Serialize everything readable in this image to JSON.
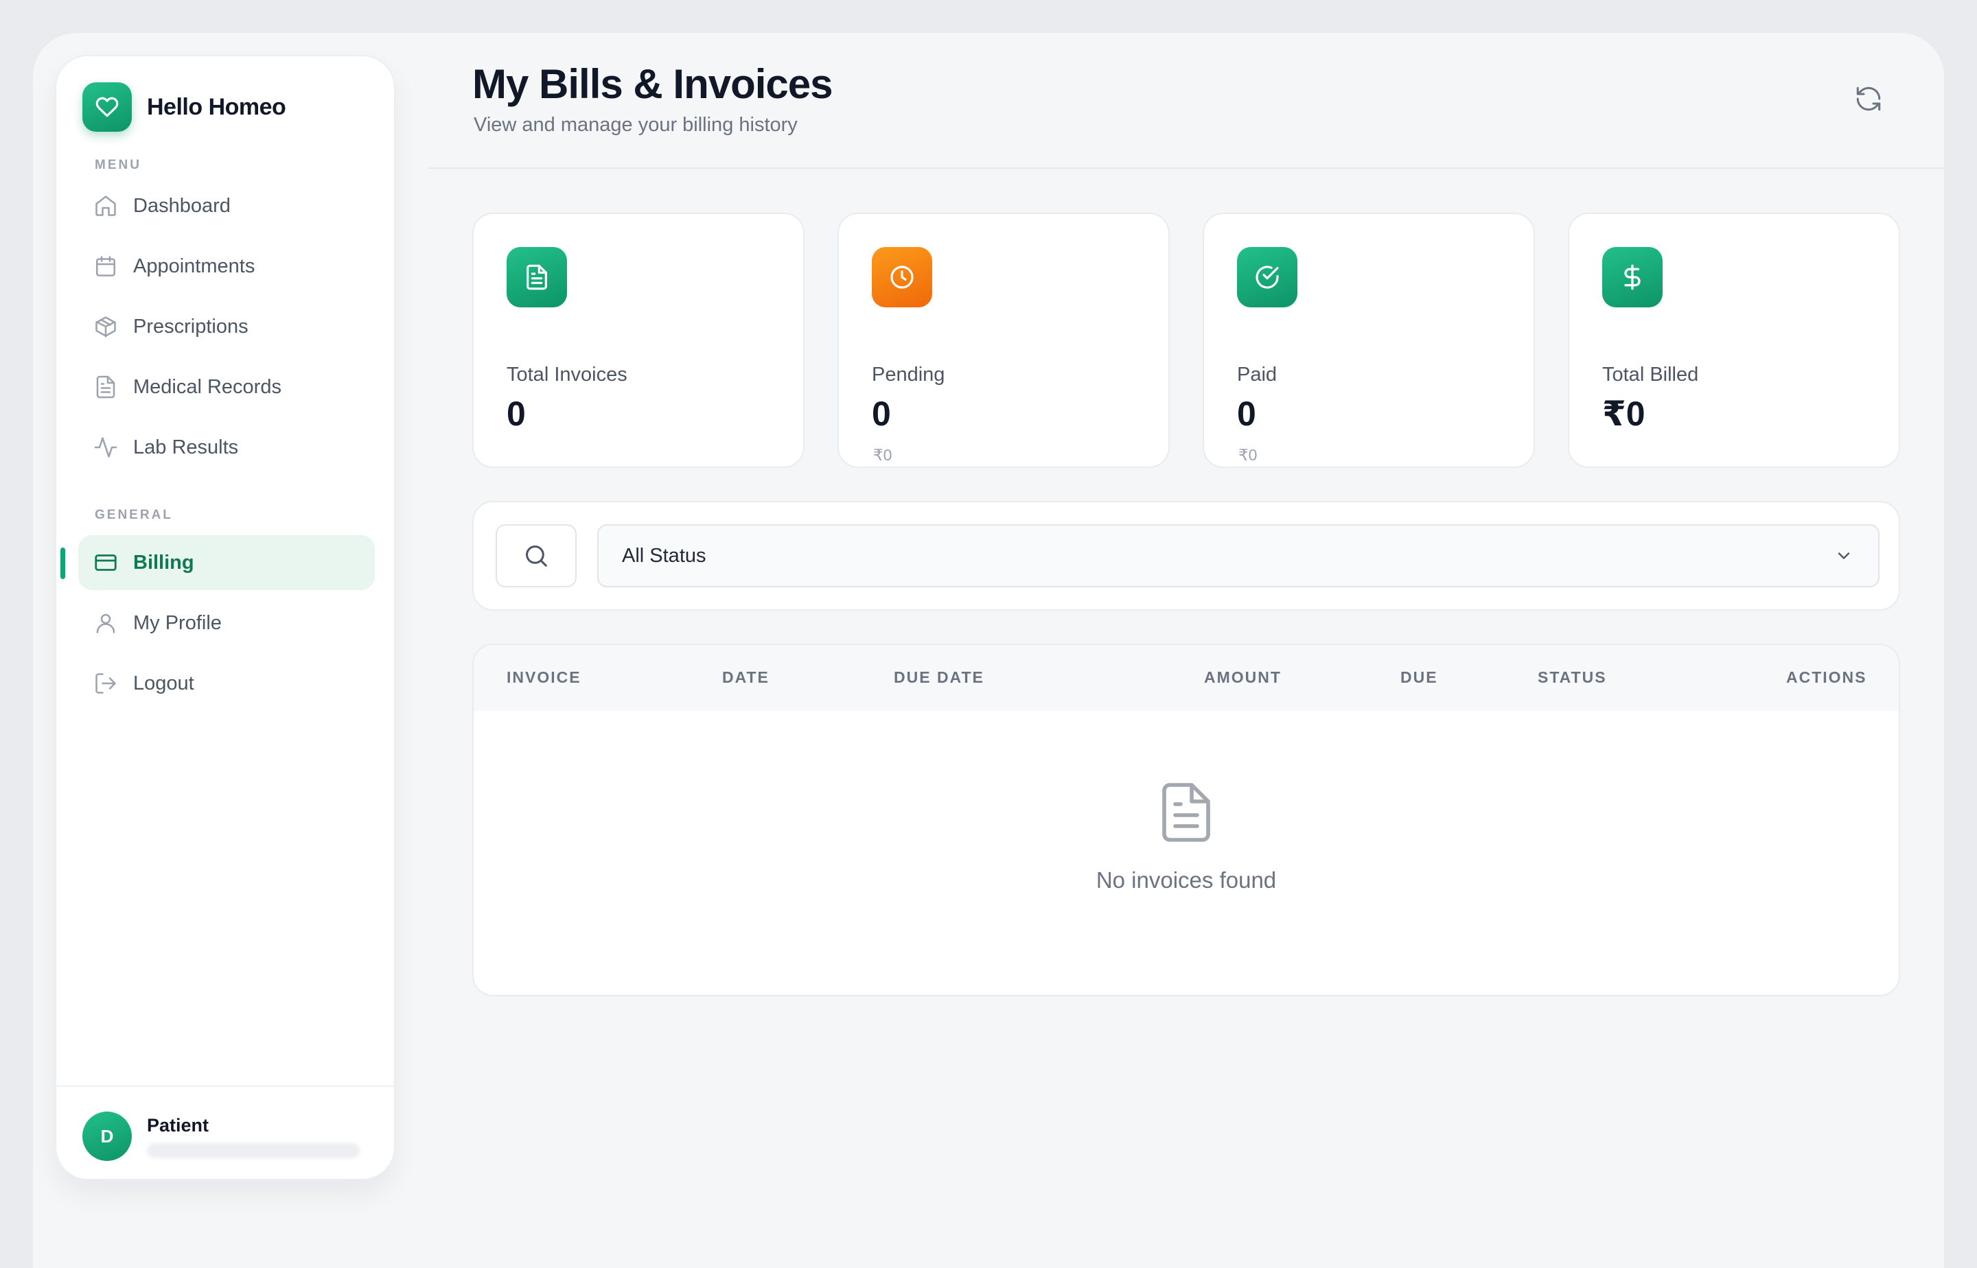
{
  "brand": {
    "name": "Hello Homeo",
    "icon": "heart-icon"
  },
  "sidebar": {
    "menu_label": "MENU",
    "general_label": "GENERAL",
    "menu_items": [
      {
        "label": "Dashboard",
        "icon": "home-icon"
      },
      {
        "label": "Appointments",
        "icon": "calendar-icon"
      },
      {
        "label": "Prescriptions",
        "icon": "package-icon"
      },
      {
        "label": "Medical Records",
        "icon": "file-text-icon"
      },
      {
        "label": "Lab Results",
        "icon": "activity-icon"
      }
    ],
    "general_items": [
      {
        "label": "Billing",
        "icon": "credit-card-icon",
        "active": true
      },
      {
        "label": "My Profile",
        "icon": "user-icon"
      },
      {
        "label": "Logout",
        "icon": "logout-icon"
      }
    ],
    "user": {
      "initial": "D",
      "role": "Patient"
    }
  },
  "header": {
    "title": "My Bills & Invoices",
    "subtitle": "View and manage your billing history",
    "refresh_icon": "refresh-icon"
  },
  "stats": [
    {
      "label": "Total Invoices",
      "value": "0",
      "icon": "file-text-icon",
      "color": "#10a673"
    },
    {
      "label": "Pending",
      "value": "0",
      "sub": "₹0",
      "icon": "clock-icon",
      "color": "#f77f10"
    },
    {
      "label": "Paid",
      "value": "0",
      "sub": "₹0",
      "icon": "check-circle-icon",
      "color": "#10a673"
    },
    {
      "label": "Total Billed",
      "value": "₹0",
      "icon": "dollar-icon",
      "color": "#10a673"
    }
  ],
  "filters": {
    "search_icon": "search-icon",
    "status_value": "All Status"
  },
  "table": {
    "columns": [
      "INVOICE",
      "DATE",
      "DUE DATE",
      "AMOUNT",
      "DUE",
      "STATUS",
      "ACTIONS"
    ],
    "empty_text": "No invoices found"
  },
  "colors": {
    "brand": "#10a673",
    "brand_dark": "#0f7a55",
    "accent_orange": "#f77f10",
    "active_bg": "#e8f6ef"
  }
}
